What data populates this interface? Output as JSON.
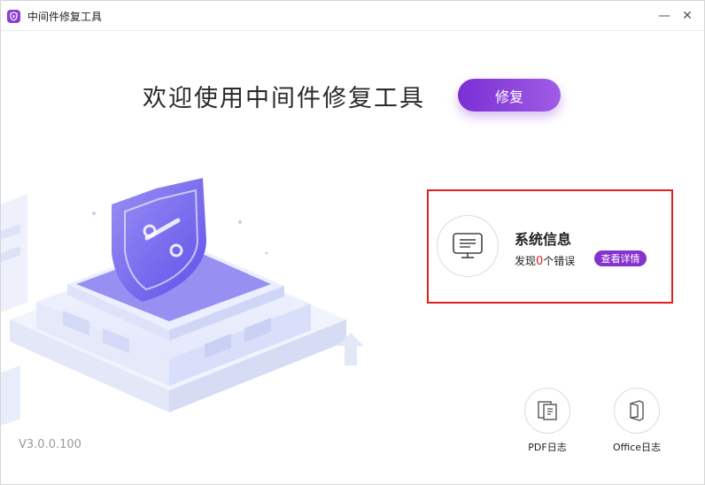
{
  "window": {
    "title": "中间件修复工具",
    "minimize_label": "—",
    "close_label": "✕"
  },
  "main": {
    "welcome_text": "欢迎使用中间件修复工具",
    "repair_label": "修复"
  },
  "system_info": {
    "title": "系统信息",
    "desc_prefix": "发现",
    "error_count": "0",
    "desc_suffix": "个错误",
    "detail_label": "查看详情",
    "icon": "monitor-icon"
  },
  "logs": [
    {
      "label": "PDF日志",
      "icon": "pdf-file-icon"
    },
    {
      "label": "Office日志",
      "icon": "office-file-icon"
    }
  ],
  "version": "V3.0.0.100",
  "colors": {
    "accent": "#8632cf",
    "accent_light": "#a05ce6",
    "error": "#e02020",
    "highlight_border": "#e02020"
  }
}
